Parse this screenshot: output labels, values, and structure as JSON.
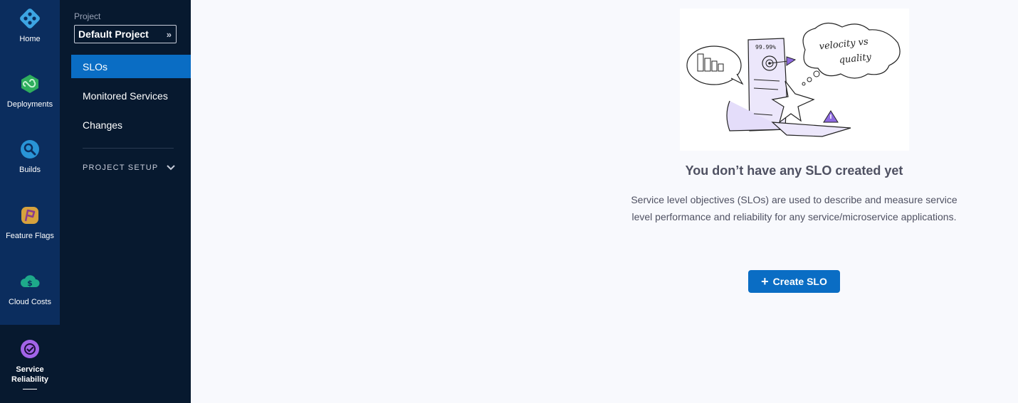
{
  "rail": {
    "items": [
      {
        "label": "Home",
        "icon": "home-icon"
      },
      {
        "label": "Deployments",
        "icon": "deployments-icon"
      },
      {
        "label": "Builds",
        "icon": "builds-icon"
      },
      {
        "label": "Feature Flags",
        "icon": "feature-flags-icon"
      },
      {
        "label": "Cloud Costs",
        "icon": "cloud-costs-icon"
      },
      {
        "label_line1": "Service",
        "label_line2": "Reliability",
        "icon": "service-reliability-icon",
        "active": true
      }
    ]
  },
  "nav": {
    "project_label": "Project",
    "project_value": "Default Project",
    "links": [
      "SLOs",
      "Monitored Services",
      "Changes"
    ],
    "active_link": "SLOs",
    "section": "PROJECT SETUP"
  },
  "illustration": {
    "note_text": "99.99%",
    "bubble_line1": "velocity vs",
    "bubble_line2": "quality"
  },
  "empty_state": {
    "title": "You don’t have any SLO created yet",
    "description": "Service level objectives (SLOs) are used to describe and measure service level performance and reliability for any service/microservice applications.",
    "button_label": "Create SLO"
  },
  "colors": {
    "rail_bg": "#0b2d5e",
    "nav_bg": "#07192f",
    "accent": "#0a6dc4",
    "page_bg": "#f8f9fd"
  }
}
